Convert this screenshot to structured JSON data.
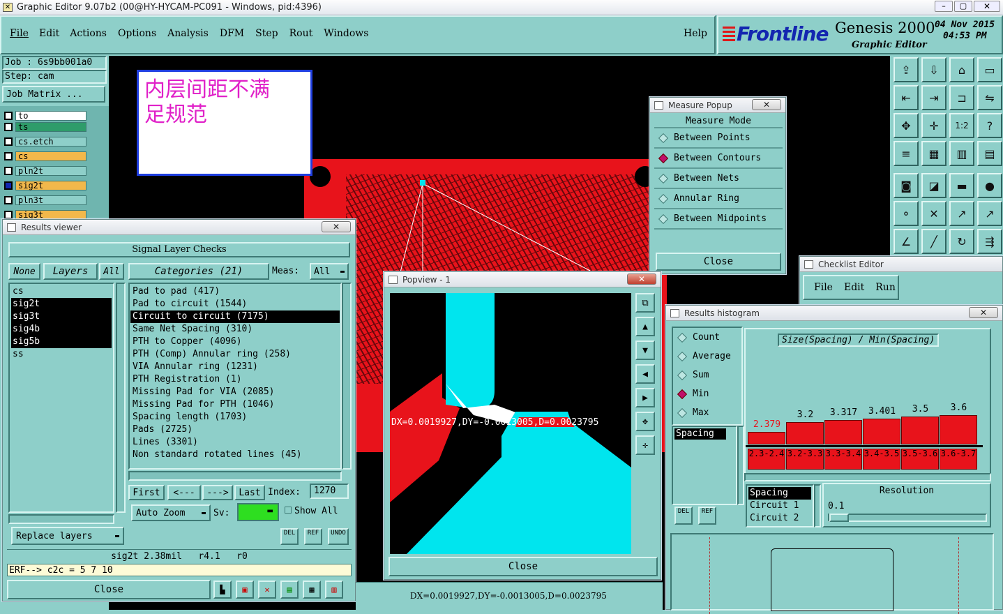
{
  "title_bar": {
    "text": "Graphic Editor 9.07b2 (00@HY-HYCAM-PC091 - Windows, pid:4396)"
  },
  "menu": {
    "items": [
      "File",
      "Edit",
      "Actions",
      "Options",
      "Analysis",
      "DFM",
      "Step",
      "Rout",
      "Windows"
    ],
    "help": "Help"
  },
  "brand": {
    "logo": "Frontline",
    "product": "Genesis 2000",
    "subtitle": "Graphic Editor",
    "date": "04 Nov 2015",
    "time": "04:53 PM"
  },
  "job": {
    "job_label": "Job : 6s9bb001a0",
    "step_label": "Step: cam",
    "matrix_button": "Job Matrix ..."
  },
  "layers": [
    {
      "name": "to",
      "color": "#ffffff"
    },
    {
      "name": "ts",
      "color": "#2e9c6a"
    },
    {
      "name": "cs.etch",
      "color": "#8ecfc9"
    },
    {
      "name": "cs",
      "color": "#f2b84b"
    },
    {
      "name": "pln2t",
      "color": "#8ecfc9"
    },
    {
      "name": "sig2t",
      "color": "#f2b84b"
    },
    {
      "name": "pln3t",
      "color": "#8ecfc9"
    },
    {
      "name": "sig3t",
      "color": "#f2b84b"
    }
  ],
  "note": {
    "text_line1": "内层间距不满",
    "text_line2": "足规范"
  },
  "results_viewer": {
    "title": "Results viewer",
    "header": "Signal Layer Checks",
    "filter_buttons": [
      "None",
      "Layers",
      "All"
    ],
    "categories_label": "Categories (21)",
    "meas_label": "Meas:",
    "meas_value": "All",
    "layers": [
      "cs",
      "sig2t",
      "sig3t",
      "sig4b",
      "sig5b",
      "ss"
    ],
    "categories": [
      "Pad to pad (417)",
      "Pad to circuit (1544)",
      "Circuit to circuit (7175)",
      "Same Net Spacing (310)",
      "PTH to Copper (4096)",
      "PTH (Comp) Annular ring (258)",
      "VIA Annular ring (1231)",
      "PTH Registration (1)",
      "Missing Pad for VIA (2085)",
      "Missing Pad for PTH (1046)",
      "Spacing length (1703)",
      "Pads (2725)",
      "Lines (3301)",
      "Non standard rotated lines (45)"
    ],
    "nav": {
      "first": "First",
      "prev": "<---",
      "next": "--->",
      "last": "Last",
      "index_label": "Index:",
      "index_value": "1270"
    },
    "auto_zoom": "Auto Zoom",
    "sv_label": "Sv:",
    "show_all": "Show All",
    "replace_layers": "Replace layers",
    "small_buttons": [
      "DEL",
      "REF",
      "UNDO"
    ],
    "status": "sig2t 2.38mil   r4.1   r0",
    "erf": "ERF--> c2c = 5 7 10",
    "close": "Close"
  },
  "measure_popup": {
    "title": "Measure Popup",
    "header": "Measure Mode",
    "options": [
      {
        "label": "Between Points",
        "selected": false
      },
      {
        "label": "Between Contours",
        "selected": true
      },
      {
        "label": "Between Nets",
        "selected": false
      },
      {
        "label": "Annular Ring",
        "selected": false
      },
      {
        "label": "Between Midpoints",
        "selected": false
      }
    ],
    "close": "Close"
  },
  "popview": {
    "title": "Popview - 1",
    "measure_text": "DX=0.0019927,DY=-0.0013005,D=0.0023795",
    "close": "Close"
  },
  "checklist_editor": {
    "title": "Checklist Editor",
    "menu": [
      "File",
      "Edit",
      "Run"
    ]
  },
  "histogram": {
    "title": "Results histogram",
    "plot_title": "Size(Spacing) / Min(Spacing)",
    "stats": [
      {
        "label": "Count",
        "selected": false
      },
      {
        "label": "Average",
        "selected": false
      },
      {
        "label": "Sum",
        "selected": false
      },
      {
        "label": "Min",
        "selected": true
      },
      {
        "label": "Max",
        "selected": false
      }
    ],
    "attribute": "Spacing",
    "resolution_label": "Resolution",
    "resolution_value": "0.1",
    "measure_list": [
      "Spacing",
      "Circuit 1",
      "Circuit 2"
    ],
    "small_buttons": [
      "DEL",
      "REF"
    ],
    "chart_data": {
      "type": "bar",
      "categories": [
        "2.3-2.4",
        "3.2-3.3",
        "3.3-3.4",
        "3.4-3.5",
        "3.5-3.6",
        "3.6-3.7"
      ],
      "values": [
        2.379,
        3.2,
        3.317,
        3.401,
        3.5,
        3.6
      ],
      "value_labels": [
        "2.379",
        "3.2",
        "3.317",
        "3.401",
        "3.5",
        "3.6"
      ]
    }
  },
  "bottom_status": {
    "text": "DX=0.0019927,DY=-0.0013005,D=0.0023795",
    "tour": "tour"
  },
  "colors": {
    "teal": "#8ecfc9",
    "copper_red": "#e8131b",
    "pad_cyan": "#00e5ee",
    "highlight": "#e8131b"
  }
}
